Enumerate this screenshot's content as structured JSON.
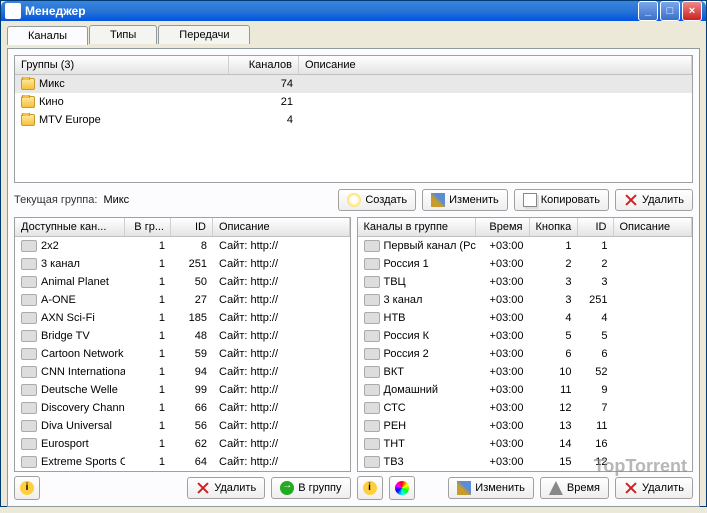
{
  "window": {
    "title": "Менеджер"
  },
  "tabs": {
    "channels": "Каналы",
    "types": "Типы",
    "programs": "Передачи"
  },
  "groups": {
    "header": {
      "name": "Группы (3)",
      "channels": "Каналов",
      "desc": "Описание"
    },
    "rows": [
      {
        "name": "Микс",
        "count": "74"
      },
      {
        "name": "Кино",
        "count": "21"
      },
      {
        "name": "MTV Europe",
        "count": "4"
      }
    ]
  },
  "current": {
    "label": "Текущая группа:",
    "value": "Микс"
  },
  "buttons": {
    "create": "Создать",
    "edit": "Изменить",
    "copy": "Копировать",
    "delete": "Удалить",
    "togroup": "В группу",
    "time": "Время"
  },
  "avail": {
    "header": {
      "name": "Доступные кан...",
      "ingrp": "В гр...",
      "id": "ID",
      "desc": "Описание"
    },
    "rows": [
      {
        "name": "2x2",
        "g": "1",
        "id": "8",
        "desc": "Сайт: http://"
      },
      {
        "name": "3 канал",
        "g": "1",
        "id": "251",
        "desc": "Сайт: http://"
      },
      {
        "name": "Animal Planet",
        "g": "1",
        "id": "50",
        "desc": "Сайт: http://"
      },
      {
        "name": "A-ONE",
        "g": "1",
        "id": "27",
        "desc": "Сайт: http://"
      },
      {
        "name": "AXN Sci-Fi",
        "g": "1",
        "id": "185",
        "desc": "Сайт: http://"
      },
      {
        "name": "Bridge TV",
        "g": "1",
        "id": "48",
        "desc": "Сайт: http://"
      },
      {
        "name": "Cartoon Network",
        "g": "1",
        "id": "59",
        "desc": "Сайт: http://"
      },
      {
        "name": "CNN International",
        "g": "1",
        "id": "94",
        "desc": "Сайт: http://"
      },
      {
        "name": "Deutsche Welle",
        "g": "1",
        "id": "99",
        "desc": "Сайт: http://"
      },
      {
        "name": "Discovery Channel",
        "g": "1",
        "id": "66",
        "desc": "Сайт: http://"
      },
      {
        "name": "Diva Universal",
        "g": "1",
        "id": "56",
        "desc": "Сайт: http://"
      },
      {
        "name": "Eurosport",
        "g": "1",
        "id": "62",
        "desc": "Сайт: http://"
      },
      {
        "name": "Extreme Sports Ch",
        "g": "1",
        "id": "64",
        "desc": "Сайт: http://"
      }
    ]
  },
  "ingroup": {
    "header": {
      "name": "Каналы в группе",
      "time": "Время",
      "btn": "Кнопка",
      "id": "ID",
      "desc": "Описание"
    },
    "rows": [
      {
        "name": "Первый канал (Рс",
        "time": "+03:00",
        "btn": "1",
        "id": "1"
      },
      {
        "name": "Россия 1",
        "time": "+03:00",
        "btn": "2",
        "id": "2"
      },
      {
        "name": "ТВЦ",
        "time": "+03:00",
        "btn": "3",
        "id": "3"
      },
      {
        "name": "3 канал",
        "time": "+03:00",
        "btn": "3",
        "id": "251"
      },
      {
        "name": "НТВ",
        "time": "+03:00",
        "btn": "4",
        "id": "4"
      },
      {
        "name": "Россия К",
        "time": "+03:00",
        "btn": "5",
        "id": "5"
      },
      {
        "name": "Россия 2",
        "time": "+03:00",
        "btn": "6",
        "id": "6"
      },
      {
        "name": "ВКТ",
        "time": "+03:00",
        "btn": "10",
        "id": "52"
      },
      {
        "name": "Домашний",
        "time": "+03:00",
        "btn": "11",
        "id": "9"
      },
      {
        "name": "СТС",
        "time": "+03:00",
        "btn": "12",
        "id": "7"
      },
      {
        "name": "РЕН",
        "time": "+03:00",
        "btn": "13",
        "id": "11"
      },
      {
        "name": "ТНТ",
        "time": "+03:00",
        "btn": "14",
        "id": "16"
      },
      {
        "name": "ТВ3",
        "time": "+03:00",
        "btn": "15",
        "id": "12"
      }
    ]
  },
  "watermark": "TopTorrent"
}
